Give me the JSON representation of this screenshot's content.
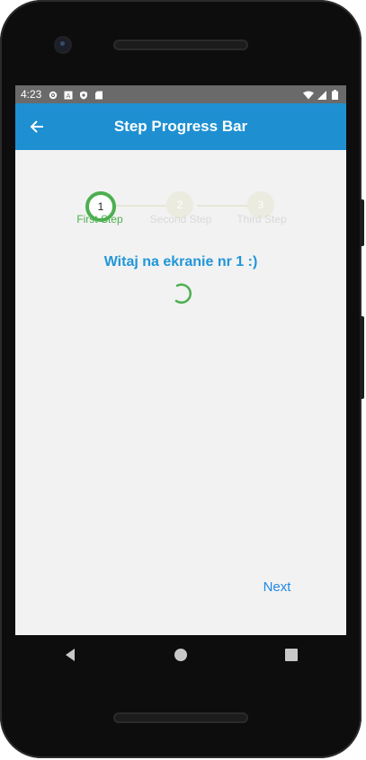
{
  "status_bar": {
    "time": "4:23",
    "left_icons": [
      "settings-icon",
      "a-badge-icon",
      "shield-icon",
      "sd-card-icon"
    ],
    "right_icons": [
      "wifi-icon",
      "signal-icon",
      "battery-icon"
    ]
  },
  "app_bar": {
    "title": "Step Progress Bar",
    "back_icon": "arrow-back-icon",
    "background": "#1e90d2"
  },
  "stepper": {
    "steps": [
      {
        "number": "1",
        "label": "First Step",
        "state": "active"
      },
      {
        "number": "2",
        "label": "Second Step",
        "state": "inactive"
      },
      {
        "number": "3",
        "label": "Third Step",
        "state": "inactive"
      }
    ],
    "active_color": "#4caf50",
    "inactive_color": "#ebebdf"
  },
  "content": {
    "welcome_text": "Witaj na ekranie nr 1 :)",
    "loading_icon": "spinner-icon"
  },
  "footer": {
    "next_label": "Next"
  },
  "nav_bar": {
    "icons": [
      "nav-back-icon",
      "nav-home-icon",
      "nav-recents-icon"
    ]
  }
}
